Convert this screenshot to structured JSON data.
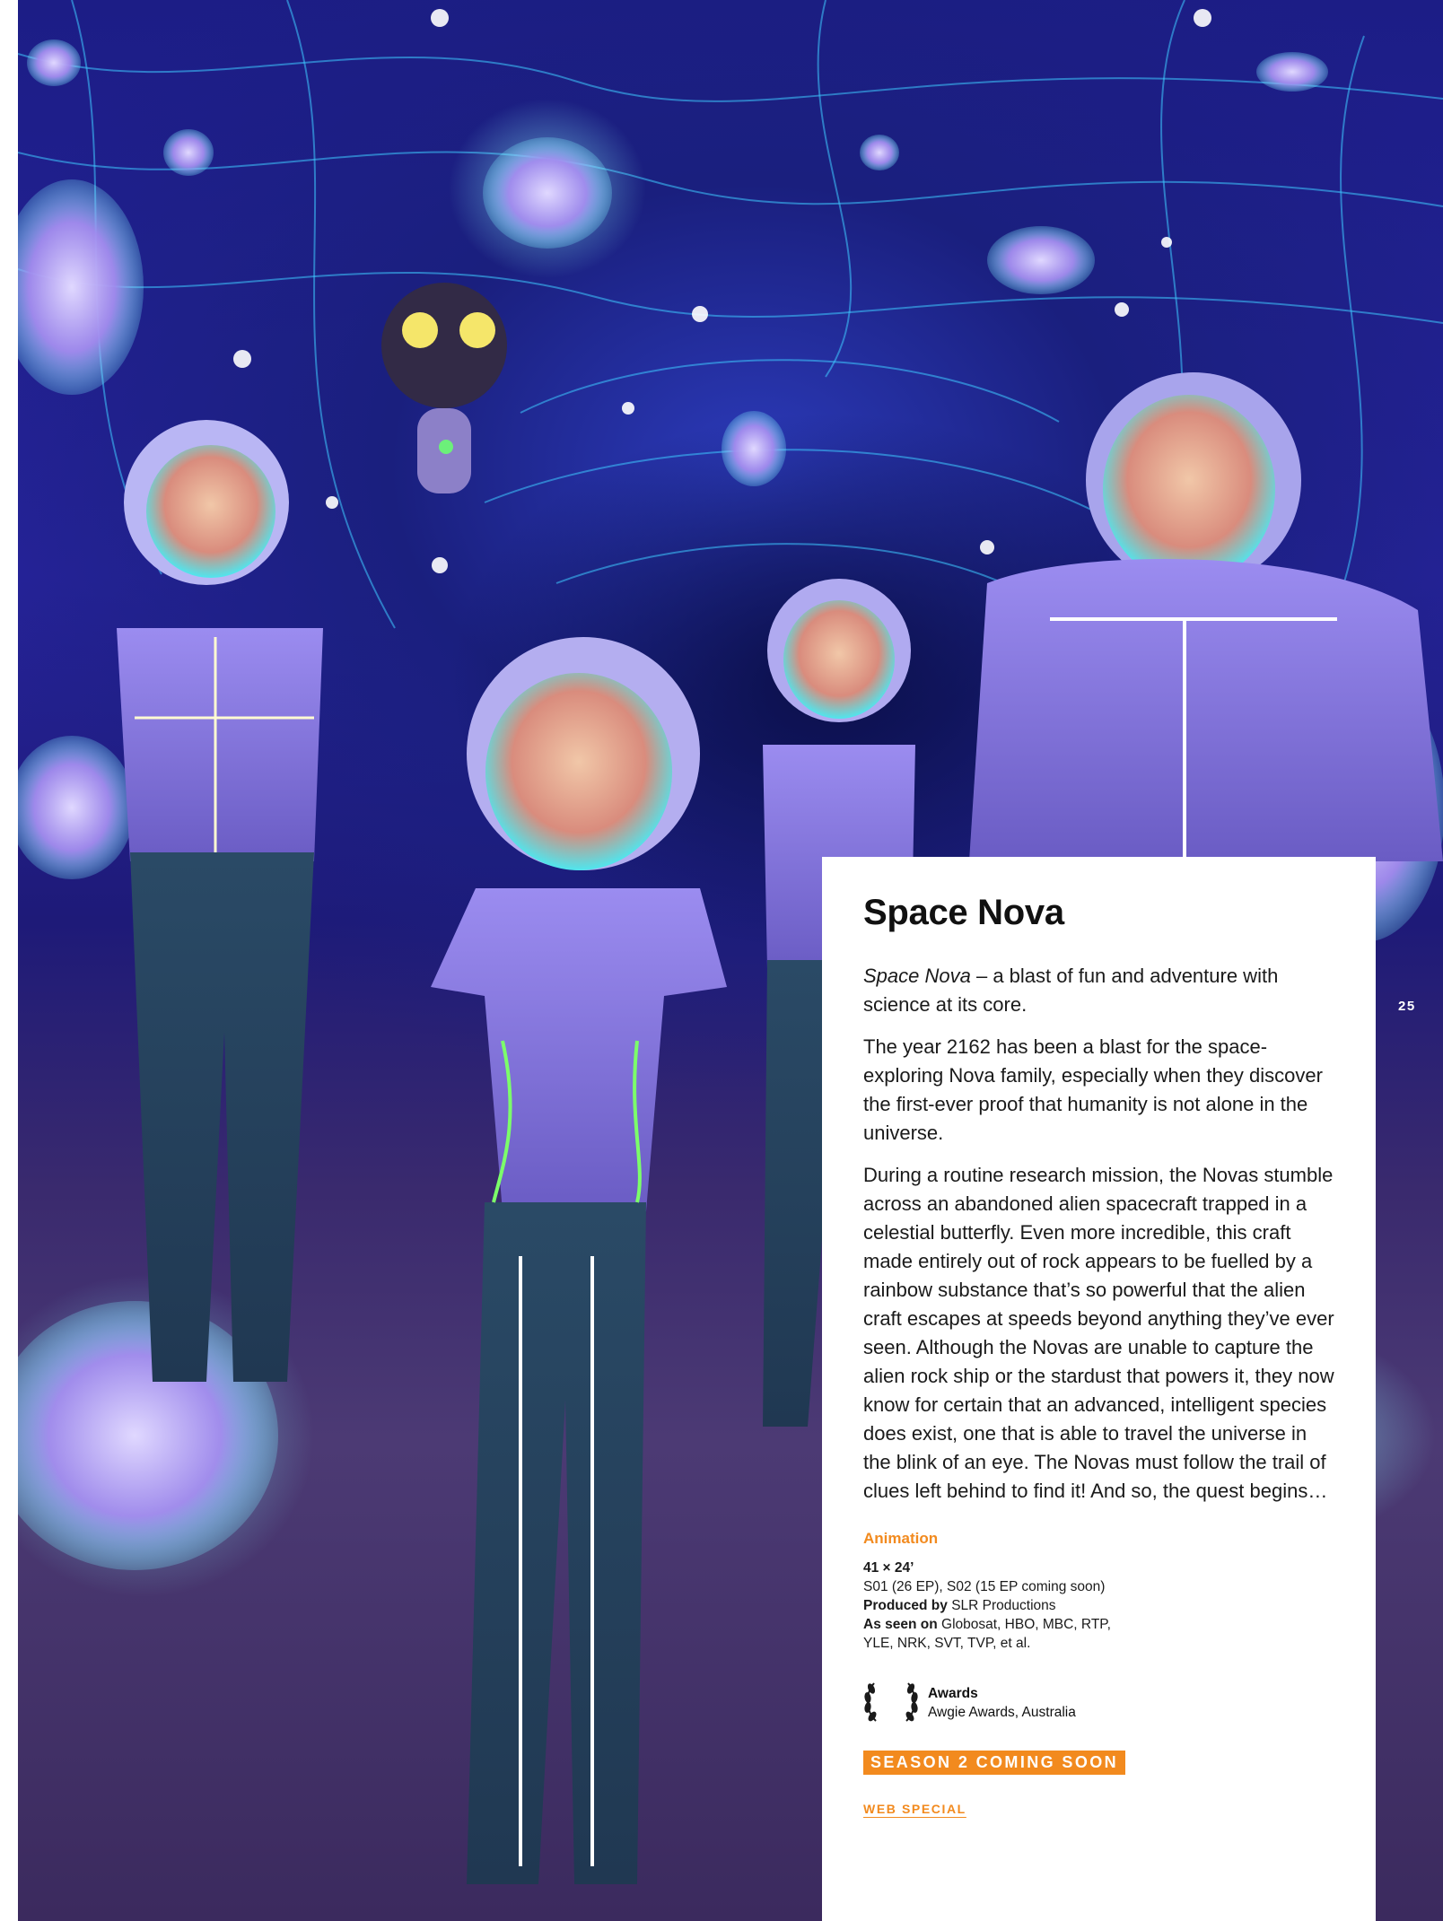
{
  "article": {
    "title": "Space Nova",
    "intro_italic": "Space Nova",
    "intro_rest": " – a blast of fun and adventure with science at its core.",
    "paragraph_2": "The year 2162 has been a blast for the space-exploring Nova family, especially when they discover the first-ever proof that humanity is not alone in the universe.",
    "paragraph_3": "During a routine research mission, the Novas stumble across an abandoned alien spacecraft trapped in a celestial butterfly. Even more incredible, this craft made entirely out of rock appears to be fuelled by a rainbow substance that’s so powerful that the alien craft escapes at speeds beyond anything they’ve ever seen. Although the Novas are unable to capture the alien rock ship or the stardust that powers it, they now know for certain that an advanced, intelligent species does exist, one that is able to travel the universe in the blink of an eye. The Novas must follow the trail of clues left behind to find it! And so, the quest begins…"
  },
  "details": {
    "genre": "Animation",
    "format": "41 × 24’",
    "seasons": "S01 (26 EP), S02 (15 EP coming soon)",
    "produced_by_label": "Produced by",
    "produced_by": " SLR Productions",
    "seen_on_label": "As seen on",
    "seen_on_line1": " Globosat, HBO, MBC, RTP,",
    "seen_on_line2": "YLE, NRK, SVT, TVP, et al."
  },
  "awards": {
    "heading": "Awards",
    "value": "Awgie Awards, Australia",
    "icon": "laurel-wreath-icon"
  },
  "badges": {
    "season": "SEASON 2 COMING SOON",
    "web_special": "WEB SPECIAL"
  },
  "page_number": "25",
  "colors": {
    "accent": "#f28a1e",
    "background_art": "#26239a",
    "text": "#111111"
  }
}
